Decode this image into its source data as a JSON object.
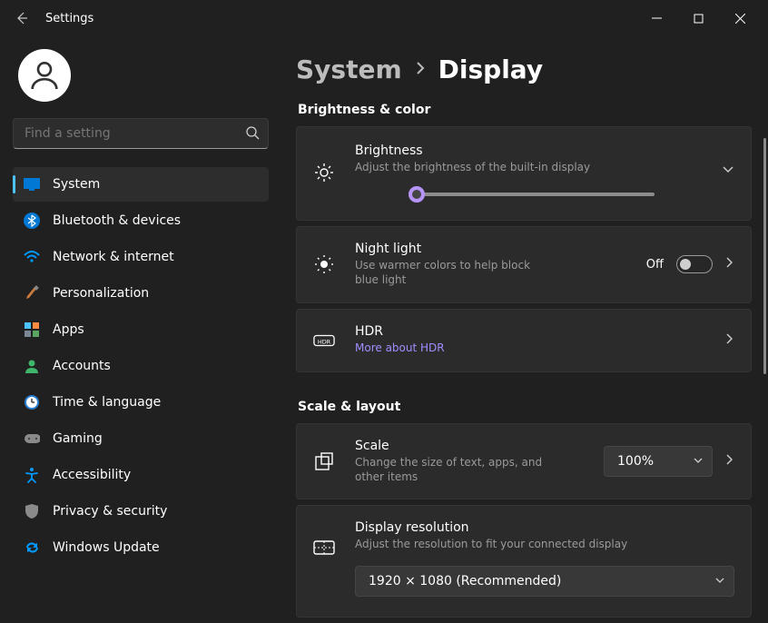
{
  "window": {
    "app_title": "Settings"
  },
  "search": {
    "placeholder": "Find a setting"
  },
  "nav": {
    "system": "System",
    "bluetooth": "Bluetooth & devices",
    "network": "Network & internet",
    "personalization": "Personalization",
    "apps": "Apps",
    "accounts": "Accounts",
    "time": "Time & language",
    "gaming": "Gaming",
    "accessibility": "Accessibility",
    "privacy": "Privacy & security",
    "update": "Windows Update"
  },
  "breadcrumb": {
    "root": "System",
    "page": "Display"
  },
  "sections": {
    "brightness_color": "Brightness & color",
    "scale_layout": "Scale & layout"
  },
  "brightness": {
    "title": "Brightness",
    "sub": "Adjust the brightness of the built-in display"
  },
  "nightlight": {
    "title": "Night light",
    "sub": "Use warmer colors to help block blue light",
    "state": "Off"
  },
  "hdr": {
    "title": "HDR",
    "link": "More about HDR"
  },
  "scale": {
    "title": "Scale",
    "sub": "Change the size of text, apps, and other items",
    "value": "100%"
  },
  "resolution": {
    "title": "Display resolution",
    "sub": "Adjust the resolution to fit your connected display",
    "value": "1920 × 1080 (Recommended)"
  }
}
